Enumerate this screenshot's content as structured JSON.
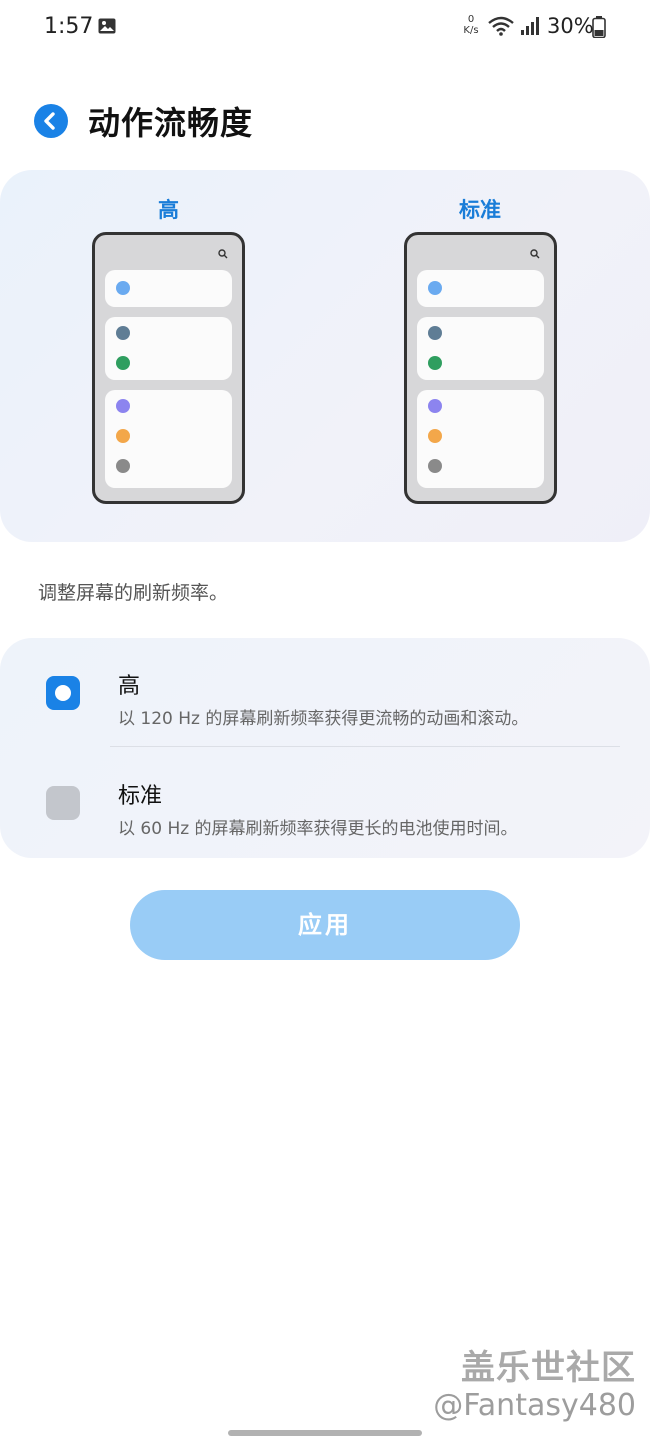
{
  "status_bar": {
    "time": "1:57",
    "net_speed_value": "0",
    "net_speed_unit": "K/s",
    "battery": "30%"
  },
  "header": {
    "title": "动作流畅度"
  },
  "preview": {
    "left_label": "高",
    "right_label": "标准",
    "dot_colors": [
      "#6aaaf0",
      "#5f7d95",
      "#2f9e5f",
      "#8c84ef",
      "#f3a74a",
      "#8a8a8a"
    ]
  },
  "description": "调整屏幕的刷新频率。",
  "options": [
    {
      "title": "高",
      "description": "以 120 Hz 的屏幕刷新频率获得更流畅的动画和滚动。",
      "selected": true
    },
    {
      "title": "标准",
      "description": "以 60 Hz 的屏幕刷新频率获得更长的电池使用时间。",
      "selected": false
    }
  ],
  "apply_label": "应用",
  "watermark": {
    "title": "盖乐世社区",
    "user": "@Fantasy480"
  },
  "colors": {
    "accent": "#1a82e6",
    "label_blue": "#1a7dd8",
    "apply_button": "#99ccf6"
  }
}
